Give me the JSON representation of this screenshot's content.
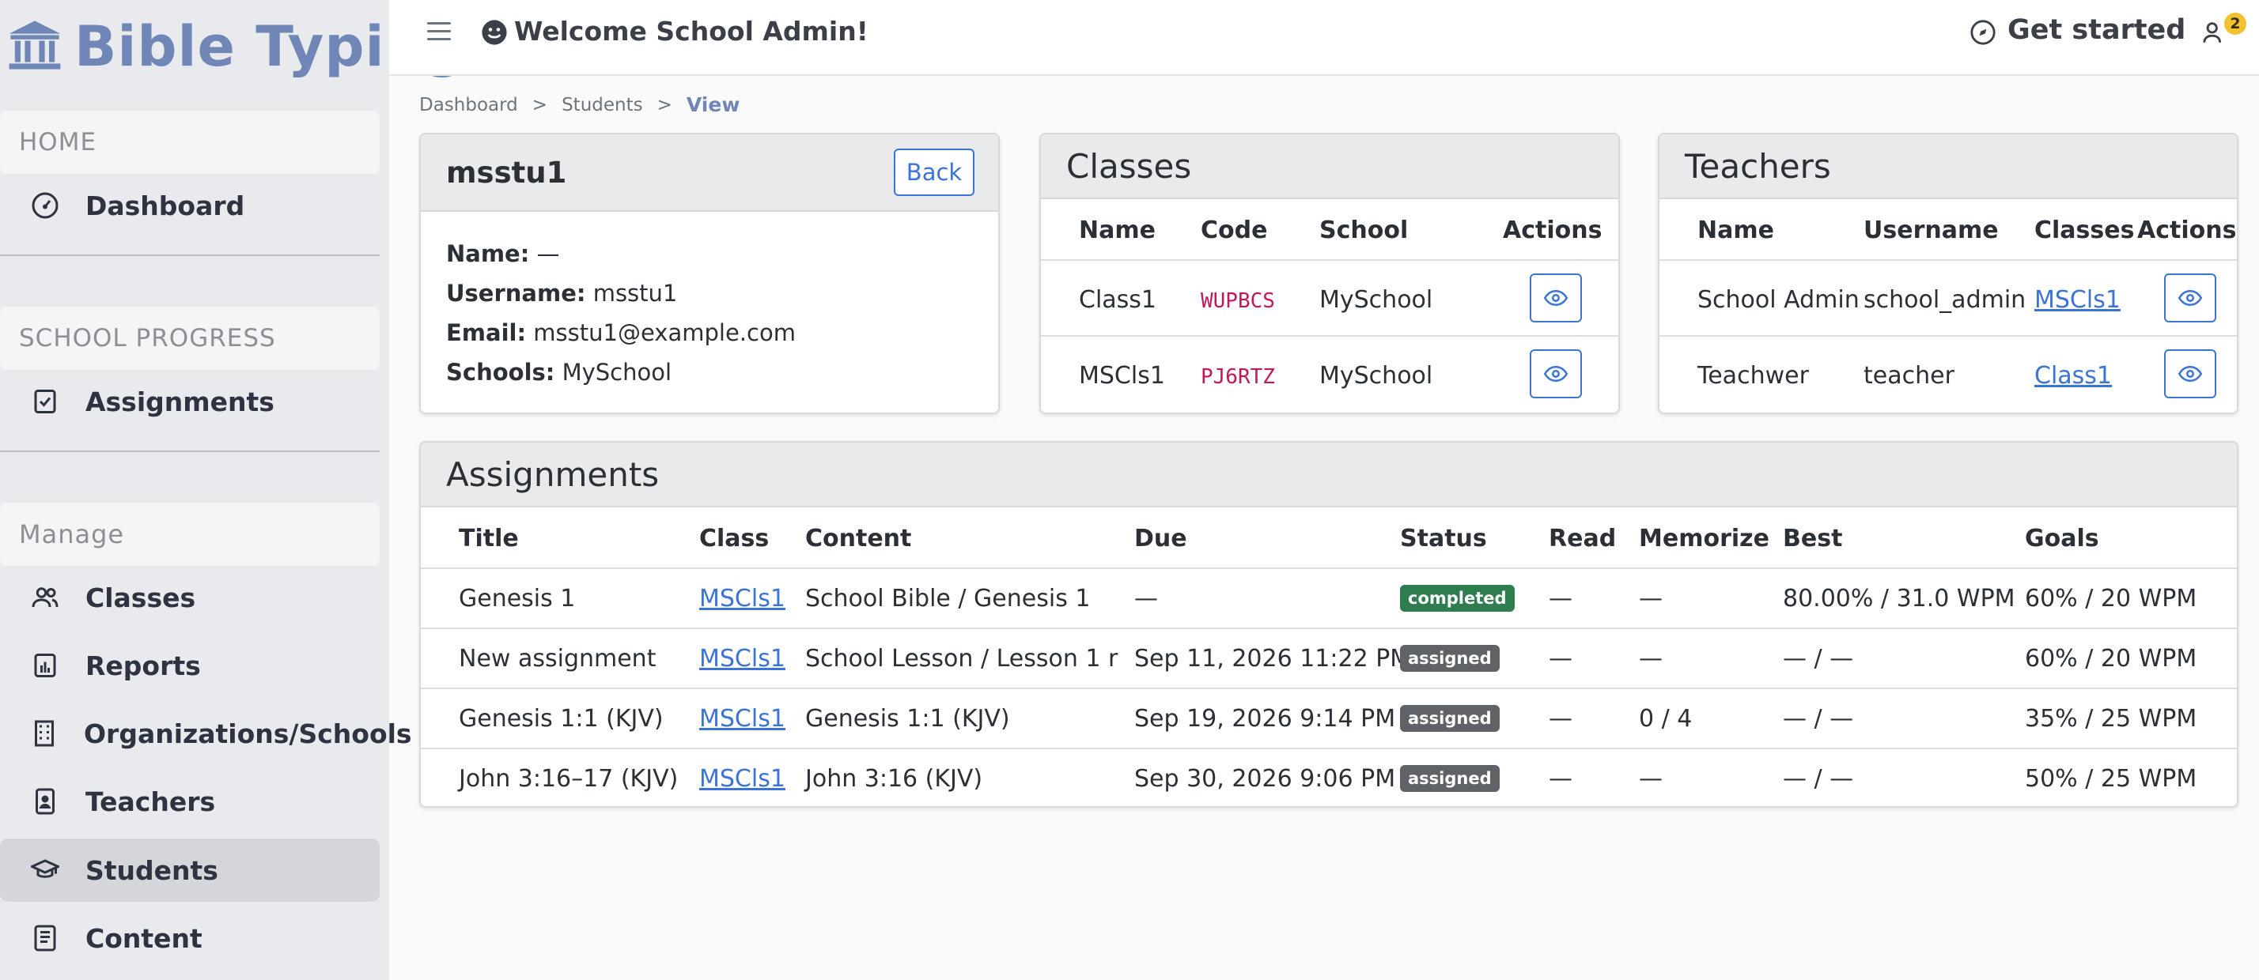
{
  "app": {
    "brand": "Bible Typing"
  },
  "sidebar": {
    "sections": [
      {
        "title": "HOME",
        "items": [
          {
            "label": "Dashboard",
            "icon": "gauge-icon"
          }
        ]
      },
      {
        "title": "SCHOOL PROGRESS",
        "items": [
          {
            "label": "Assignments",
            "icon": "checklist-icon"
          }
        ]
      },
      {
        "title": "Manage",
        "items": [
          {
            "label": "Classes",
            "icon": "people-icon"
          },
          {
            "label": "Reports",
            "icon": "bar-chart-icon"
          },
          {
            "label": "Organizations/Schools",
            "icon": "building-icon"
          },
          {
            "label": "Teachers",
            "icon": "id-badge-icon"
          },
          {
            "label": "Students",
            "icon": "graduation-cap-icon",
            "active": true
          },
          {
            "label": "Content",
            "icon": "document-icon"
          }
        ]
      }
    ]
  },
  "topbar": {
    "welcome": "Welcome School Admin!",
    "get_started": "Get started",
    "notification_count": "2"
  },
  "breadcrumb": {
    "items": [
      "Dashboard",
      "Students"
    ],
    "separator": ">",
    "current": "View"
  },
  "profile": {
    "title": "msstu1",
    "back_label": "Back",
    "fields": [
      {
        "label": "Name:",
        "value": "—"
      },
      {
        "label": "Username:",
        "value": "msstu1"
      },
      {
        "label": "Email:",
        "value": "msstu1@example.com"
      },
      {
        "label": "Schools:",
        "value": "MySchool"
      }
    ]
  },
  "classes": {
    "title": "Classes",
    "columns": [
      "Name",
      "Code",
      "School",
      "Actions"
    ],
    "rows": [
      {
        "name": "Class1",
        "code": "WUPBCS",
        "school": "MySchool"
      },
      {
        "name": "MSCls1",
        "code": "PJ6RTZ",
        "school": "MySchool"
      }
    ]
  },
  "teachers": {
    "title": "Teachers",
    "columns": [
      "Name",
      "Username",
      "Classes",
      "Actions"
    ],
    "rows": [
      {
        "name": "School Admin",
        "username": "school_admin",
        "classes": "MSCls1"
      },
      {
        "name": "Teachwer",
        "username": "teacher",
        "classes": "Class1"
      }
    ]
  },
  "assignments": {
    "title": "Assignments",
    "columns": [
      "Title",
      "Class",
      "Content",
      "Due",
      "Status",
      "Read",
      "Memorize",
      "Best",
      "Goals"
    ],
    "rows": [
      {
        "title": "Genesis 1",
        "class": "MSCls1",
        "content": "School Bible / Genesis 1",
        "due": "—",
        "status": "completed",
        "read": "—",
        "memorize": "—",
        "best": "80.00% / 31.0 WPM",
        "goals": "60% / 20 WPM"
      },
      {
        "title": "New assignment",
        "class": "MSCls1",
        "content": "School Lesson / Lesson 1 r",
        "due": "Sep 11, 2026 11:22 PM",
        "status": "assigned",
        "read": "—",
        "memorize": "—",
        "best": "— / —",
        "goals": "60% / 20 WPM"
      },
      {
        "title": "Genesis 1:1 (KJV)",
        "class": "MSCls1",
        "content": "Genesis 1:1 (KJV)",
        "due": "Sep 19, 2026 9:14 PM",
        "status": "assigned",
        "read": "—",
        "memorize": "0 / 4",
        "best": "— / —",
        "goals": "35% / 25 WPM"
      },
      {
        "title": "John 3:16–17 (KJV)",
        "class": "MSCls1",
        "content": "John 3:16 (KJV)",
        "due": "Sep 30, 2026 9:06 PM",
        "status": "assigned",
        "read": "—",
        "memorize": "—",
        "best": "— / —",
        "goals": "50% / 25 WPM"
      }
    ]
  },
  "colors": {
    "brand": "#6f86b7",
    "link": "#3b74d6",
    "code": "#c2185b",
    "completed": "#2e7d4f",
    "assigned": "#5f6368",
    "badge": "#f2c230"
  }
}
